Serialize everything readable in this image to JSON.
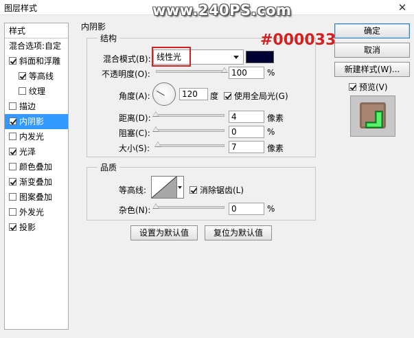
{
  "window": {
    "title": "图层样式",
    "close_glyph": "✕"
  },
  "watermark": "www.240PS.com",
  "annotation": "#000033",
  "left_panel": {
    "items": [
      {
        "label": "样式",
        "checkbox": false,
        "checked": false,
        "selected": false
      },
      {
        "label": "混合选项:自定",
        "checkbox": false,
        "checked": false,
        "selected": false
      },
      {
        "label": "斜面和浮雕",
        "checkbox": true,
        "checked": true,
        "selected": false
      },
      {
        "label": "等高线",
        "checkbox": true,
        "checked": true,
        "selected": false
      },
      {
        "label": "纹理",
        "checkbox": true,
        "checked": false,
        "selected": false
      },
      {
        "label": "描边",
        "checkbox": true,
        "checked": false,
        "selected": false
      },
      {
        "label": "内阴影",
        "checkbox": true,
        "checked": true,
        "selected": true
      },
      {
        "label": "内发光",
        "checkbox": true,
        "checked": false,
        "selected": false
      },
      {
        "label": "光泽",
        "checkbox": true,
        "checked": true,
        "selected": false
      },
      {
        "label": "颜色叠加",
        "checkbox": true,
        "checked": false,
        "selected": false
      },
      {
        "label": "渐变叠加",
        "checkbox": true,
        "checked": true,
        "selected": false
      },
      {
        "label": "图案叠加",
        "checkbox": true,
        "checked": false,
        "selected": false
      },
      {
        "label": "外发光",
        "checkbox": true,
        "checked": false,
        "selected": false
      },
      {
        "label": "投影",
        "checkbox": true,
        "checked": true,
        "selected": false
      }
    ]
  },
  "inner_shadow": {
    "section_title": "内阴影",
    "structure": {
      "title": "结构",
      "blend_mode_label": "混合模式(B):",
      "blend_mode_value": "线性光",
      "color": "#000033",
      "opacity_label": "不透明度(O):",
      "opacity_value": "100",
      "opacity_unit": "%",
      "opacity_level": 1.0,
      "angle_label": "角度(A):",
      "angle_value": "120",
      "angle_unit": "度",
      "global_light_label": "使用全局光(G)",
      "global_light_checked": true,
      "distance_label": "距离(D):",
      "distance_value": "4",
      "distance_unit": "像素",
      "distance_level": 0.0,
      "choke_label": "阻塞(C):",
      "choke_value": "0",
      "choke_unit": "%",
      "choke_level": 0.0,
      "size_label": "大小(S):",
      "size_value": "7",
      "size_unit": "像素",
      "size_level": 0.03
    },
    "quality": {
      "title": "品质",
      "contour_label": "等高线:",
      "antialias_label": "消除锯齿(L)",
      "antialias_checked": true,
      "noise_label": "杂色(N):",
      "noise_value": "0",
      "noise_unit": "%",
      "noise_level": 0.0
    },
    "make_default_label": "设置为默认值",
    "reset_default_label": "复位为默认值"
  },
  "buttons": {
    "ok": "确定",
    "cancel": "取消",
    "new_style": "新建样式(W)...",
    "preview_label": "预览(V)",
    "preview_checked": true
  },
  "colors": {
    "selection": "#3399ff",
    "annotation": "#d42020",
    "swatch": "#000033"
  }
}
